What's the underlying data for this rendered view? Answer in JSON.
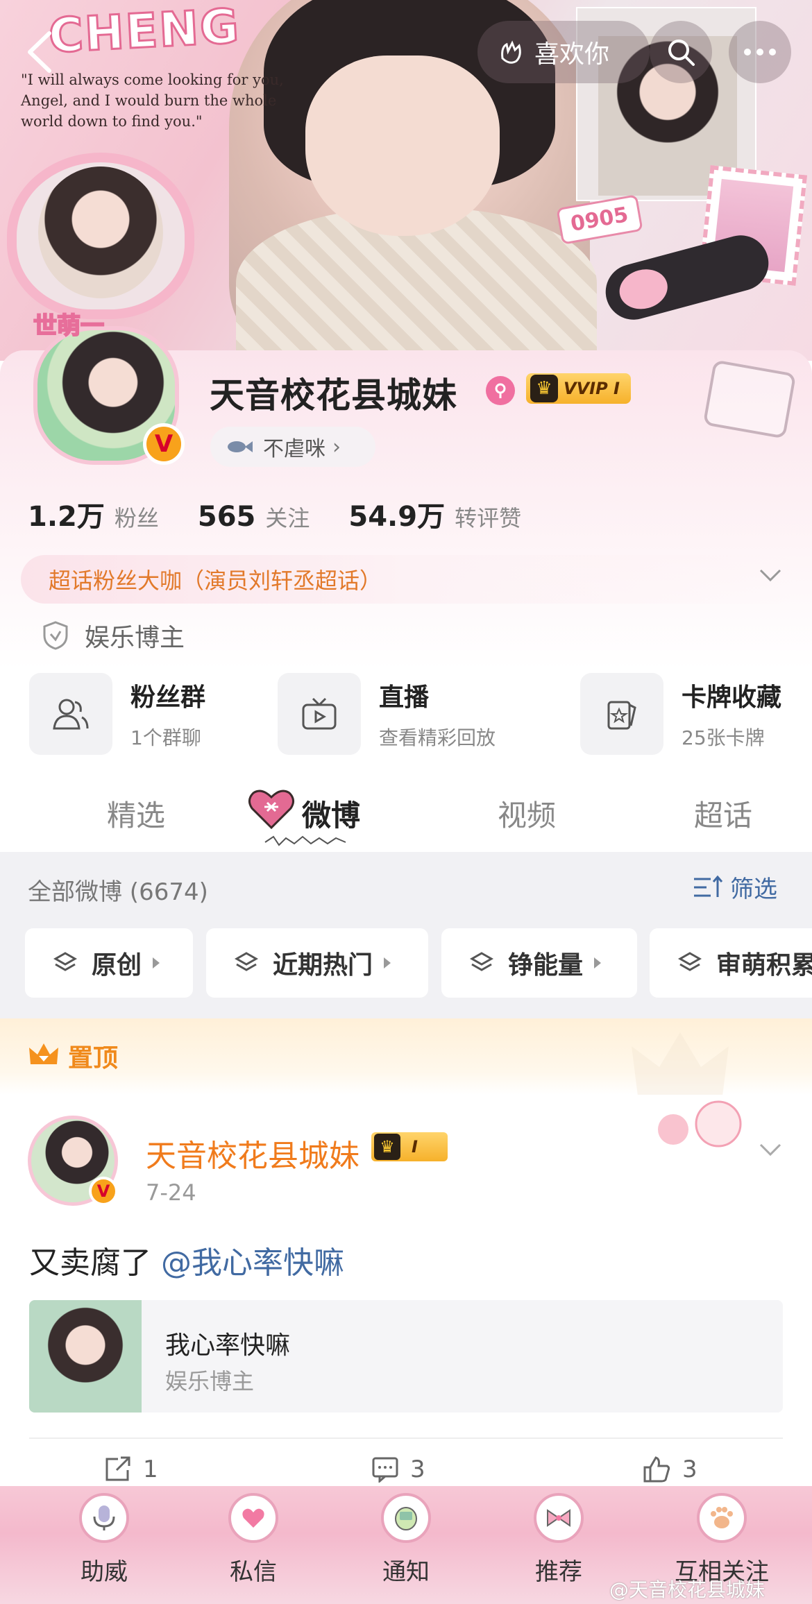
{
  "header": {
    "banner_text": "CHENG",
    "banner_quote": "\"I will always come looking for you, Angel, and I would burn the whole world down to find you.\"",
    "banner_number": "0905",
    "like_label": "喜欢你"
  },
  "profile": {
    "name": "天音校花县城妹",
    "avatar_sticker": "世萌一",
    "vip_label": "VVIP I",
    "tag_pill": "不虐咪",
    "stats": [
      {
        "value": "1.2万",
        "label": "粉丝"
      },
      {
        "value": "565",
        "label": "关注"
      },
      {
        "value": "54.9万",
        "label": "转评赞"
      }
    ],
    "supertopic": "超话粉丝大咖（演员刘轩丞超话）",
    "verification": "娱乐博主"
  },
  "features": [
    {
      "title": "粉丝群",
      "subtitle": "1个群聊"
    },
    {
      "title": "直播",
      "subtitle": "查看精彩回放"
    },
    {
      "title": "卡牌收藏",
      "subtitle": "25张卡牌"
    }
  ],
  "tabs": [
    {
      "label": "精选"
    },
    {
      "label": "微博"
    },
    {
      "label": "视频"
    },
    {
      "label": "超话"
    }
  ],
  "feed": {
    "count_label": "全部微博 (6674)",
    "filter_label": "筛选",
    "chips": [
      "原创",
      "近期热门",
      "铮能量",
      "审萌积累"
    ]
  },
  "pinned": {
    "label": "置顶",
    "author": "天音校花县城妹",
    "badge": "I",
    "date": "7-24",
    "text_prefix": "又卖腐了 ",
    "mention": "@我心率快嘛",
    "card_title": "我心率快嘛",
    "card_subtitle": "娱乐博主",
    "actions": [
      {
        "icon": "share-icon",
        "count": "1"
      },
      {
        "icon": "comment-icon",
        "count": "3"
      },
      {
        "icon": "like-icon",
        "count": "3"
      }
    ]
  },
  "bottom_nav": [
    {
      "label": "助威",
      "icon": "microphone-icon"
    },
    {
      "label": "私信",
      "icon": "heart-wings-icon"
    },
    {
      "label": "通知",
      "icon": "handheld-icon"
    },
    {
      "label": "推荐",
      "icon": "bow-icon"
    },
    {
      "label": "互相关注",
      "icon": "paw-icon"
    }
  ],
  "watermark": "@天音校花县城妹",
  "colors": {
    "accent_orange": "#f07b1c",
    "link_blue": "#416aa2",
    "pink": "#f6b6ca",
    "vip_gold": "#f6b12b"
  }
}
